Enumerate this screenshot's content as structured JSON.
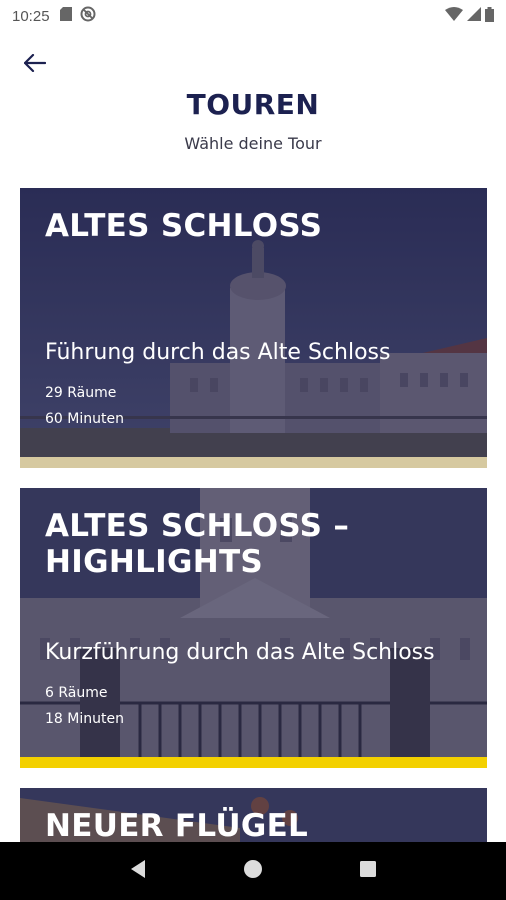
{
  "status_bar": {
    "time": "10:25",
    "left_icons": [
      "sd-card-icon",
      "at-sign-icon"
    ],
    "right_icons": [
      "wifi-icon",
      "signal-icon",
      "battery-icon"
    ]
  },
  "header": {
    "back_icon": "arrow-left-icon",
    "title": "TOUREN",
    "subtitle": "Wähle deine Tour"
  },
  "tours": [
    {
      "title": "ALTES SCHLOSS",
      "description": "Führung durch das Alte Schloss",
      "rooms": "29 Räume",
      "duration": "60 Minuten",
      "accent_color": "#d6c9a0"
    },
    {
      "title": "ALTES SCHLOSS – HIGHLIGHTS",
      "description": "Kurzführung durch das Alte Schloss",
      "rooms": "6 Räume",
      "duration": "18 Minuten",
      "accent_color": "#f3d000"
    },
    {
      "title": "NEUER FLÜGEL"
    }
  ],
  "nav_bar": {
    "buttons": [
      "back-triangle-icon",
      "home-circle-icon",
      "recents-square-icon"
    ]
  },
  "colors": {
    "primary": "#1c2150",
    "card_overlay": "#2b2f55"
  }
}
